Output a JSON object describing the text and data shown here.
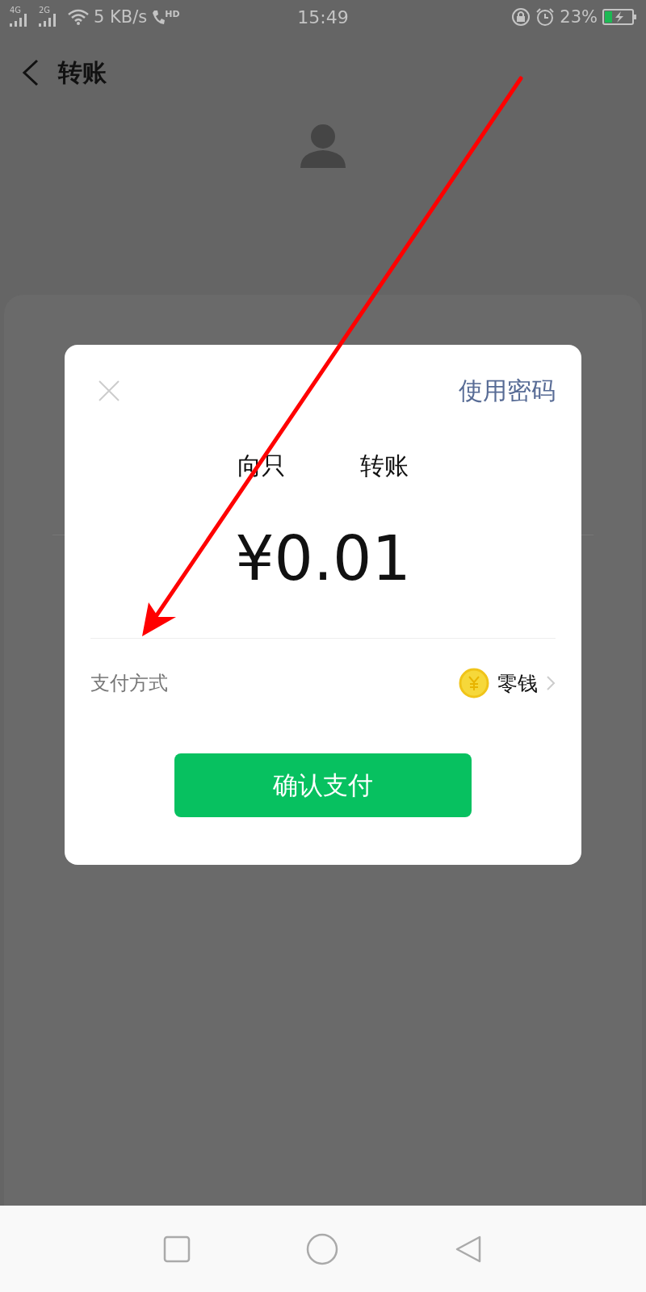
{
  "status_bar": {
    "network_1": "4G",
    "network_2": "2G",
    "speed": "5 KB/s",
    "call_badge": "HD",
    "time": "15:49",
    "battery": "23%"
  },
  "header": {
    "title": "转账"
  },
  "dialog": {
    "password_link": "使用密码",
    "recipient_prefix": "向只",
    "recipient_suffix": "转账",
    "amount": "¥0.01",
    "payment_label": "支付方式",
    "payment_method": "零钱",
    "confirm_button": "确认支付"
  }
}
